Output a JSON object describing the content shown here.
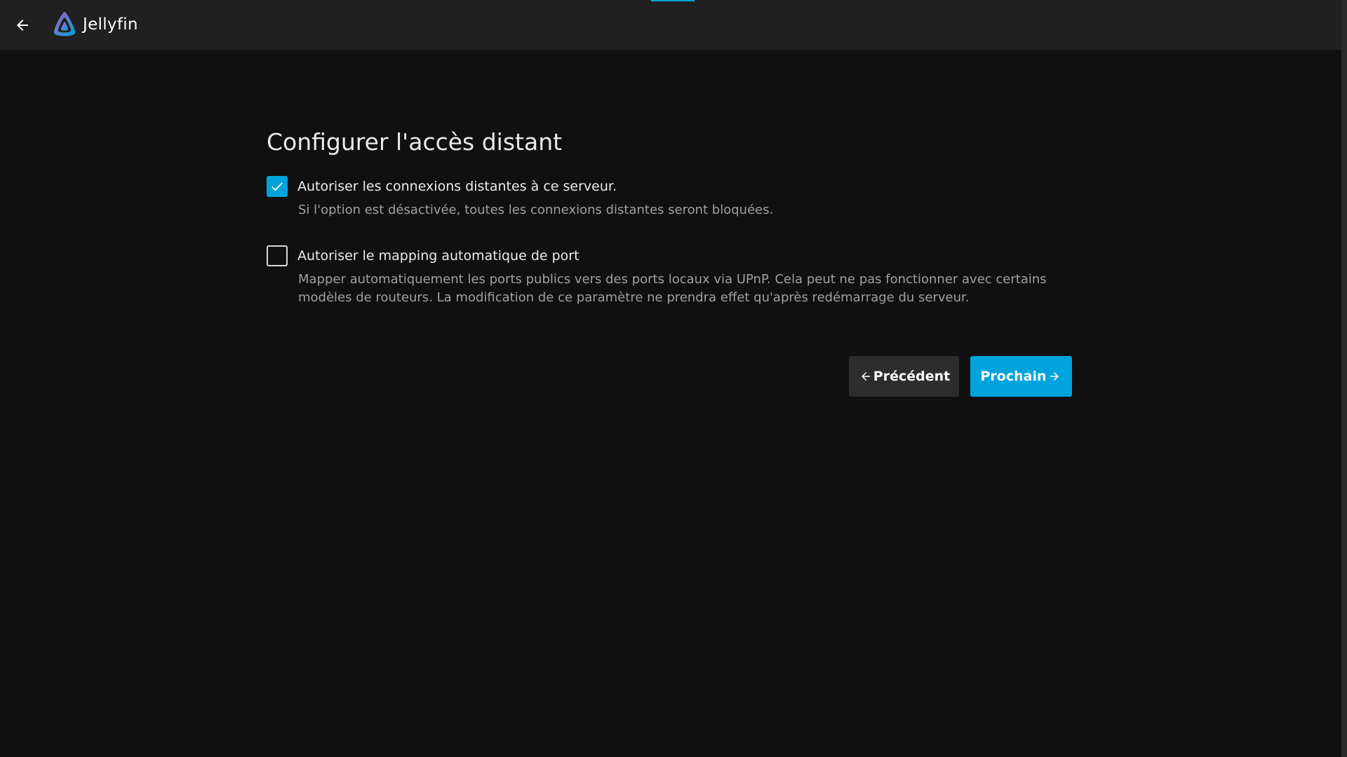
{
  "app": {
    "name": "Jellyfin",
    "accent_color": "#00a4dc"
  },
  "header": {
    "back_icon": "arrow-left-icon",
    "logo_icon": "jellyfin-logo-icon"
  },
  "wizard": {
    "title": "Configurer l'accès distant",
    "options": [
      {
        "label": "Autoriser les connexions distantes à ce serveur.",
        "description": "Si l'option est désactivée, toutes les connexions distantes seront bloquées.",
        "checked": true
      },
      {
        "label": "Autoriser le mapping automatique de port",
        "description": "Mapper automatiquement les ports publics vers des ports locaux via UPnP. Cela peut ne pas fonctionner avec certains modèles de routeurs. La modification de ce paramètre ne prendra effet qu'après redémarrage du serveur.",
        "checked": false
      }
    ],
    "prev_label": "Précédent",
    "next_label": "Prochain"
  }
}
